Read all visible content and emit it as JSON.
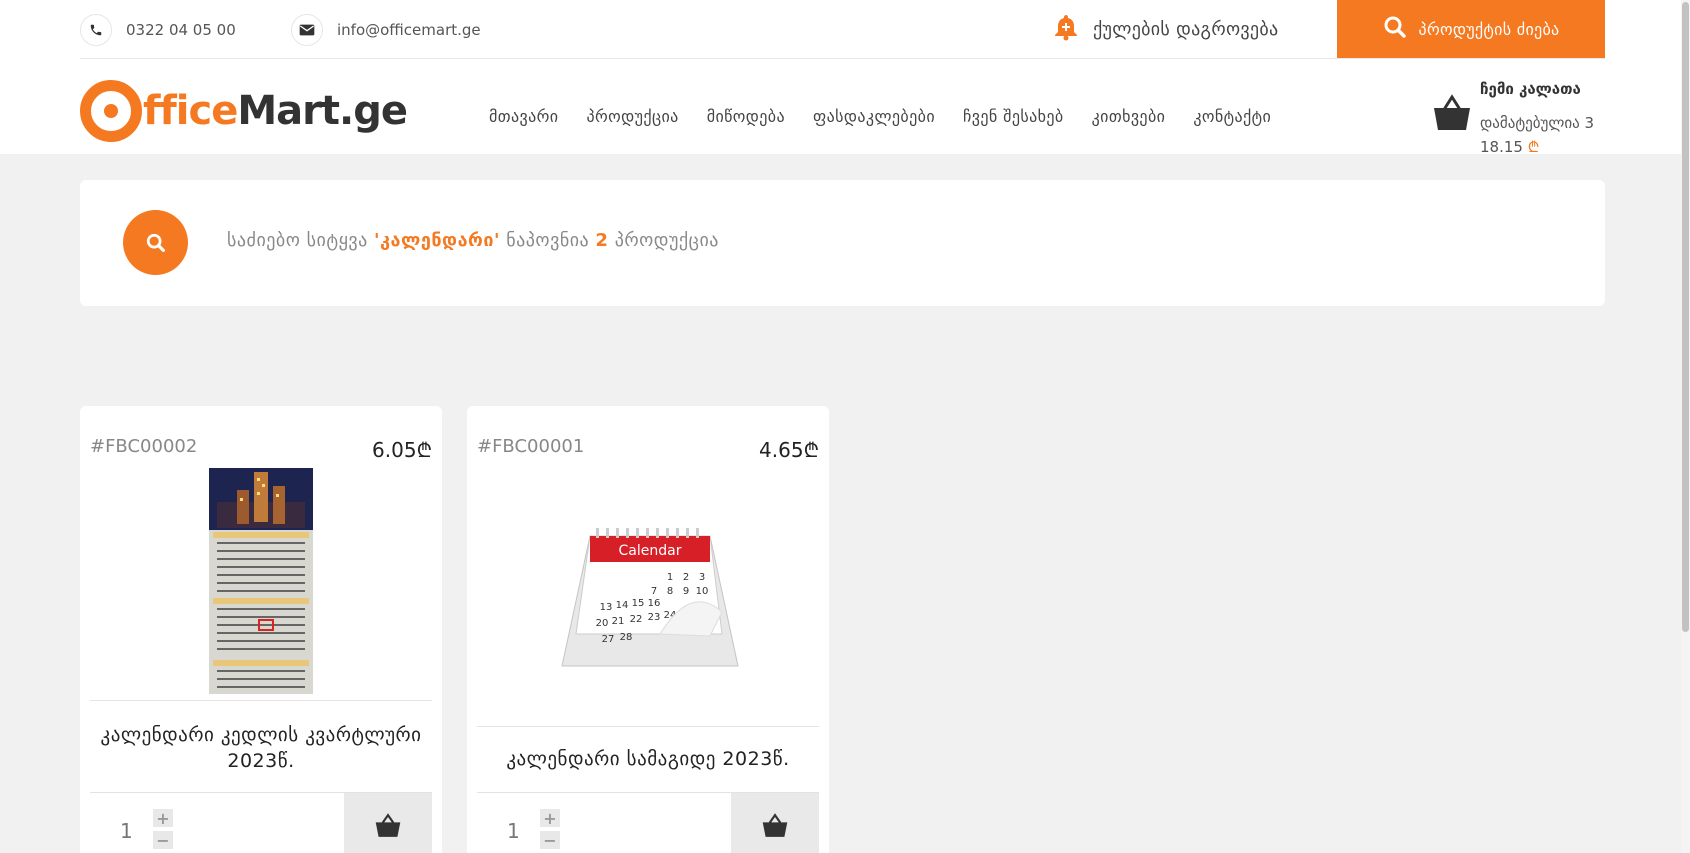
{
  "header": {
    "phone": "0322 04 05 00",
    "email": "info@officemart.ge",
    "bonus_label": "ქულების დაგროვება",
    "search_label": "პროდუქტის ძიება",
    "logo_part1": "fficeMart.ge",
    "logo_part2": ""
  },
  "nav": {
    "items": [
      {
        "label": "მთავარი"
      },
      {
        "label": "პროდუქცია"
      },
      {
        "label": "მიწოდება"
      },
      {
        "label": "ფასდაკლებები"
      },
      {
        "label": "ჩვენ შესახებ"
      },
      {
        "label": "კითხვები"
      },
      {
        "label": "კონტაქტი"
      }
    ]
  },
  "cart": {
    "title": "ჩემი კალათა",
    "added": "დამატებულია 3",
    "total": "18.15",
    "currency": "₾"
  },
  "results": {
    "prefix": "საძიებო სიტყვა",
    "keyword": "'კალენდარი'",
    "middle": "ნაპოვნია",
    "count": "2",
    "suffix": "პროდუქცია"
  },
  "products": [
    {
      "code": "#FBC00002",
      "price": "6.05₾",
      "name": "კალენდარი კედლის კვარტლური 2023წ.",
      "qty": "1",
      "image_icon": "wall-calendar-image"
    },
    {
      "code": "#FBC00001",
      "price": "4.65₾",
      "name": "კალენდარი სამაგიდე 2023წ.",
      "qty": "1",
      "image_icon": "desk-calendar-image"
    }
  ],
  "desk_calendar_header": "Calendar",
  "colors": {
    "accent": "#f47920",
    "text": "#444444",
    "background": "#f1f1f1"
  }
}
